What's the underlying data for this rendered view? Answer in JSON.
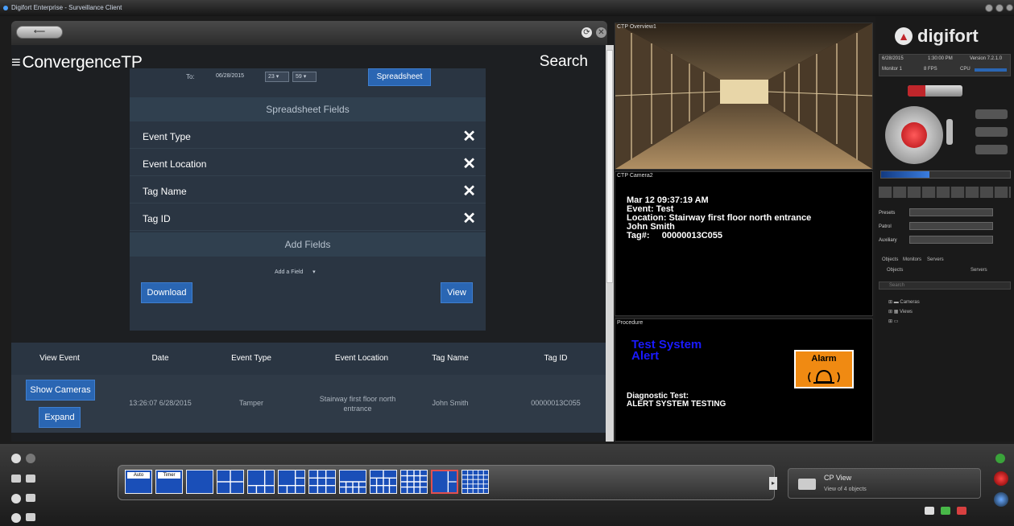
{
  "window": {
    "title": "Digifort Enterprise - Surveillance Client"
  },
  "browser": {
    "back_label": "⟵",
    "home_icon": "home-icon",
    "close_icon": "close-icon"
  },
  "app": {
    "brand": "ConvergenceTP",
    "page_title": "Search",
    "form": {
      "to_label": "To:",
      "to_date": "06/28/2015",
      "to_hour": "23 ▾",
      "to_minute": "59 ▾",
      "spreadsheet_button": "Spreadsheet",
      "spreadsheet_fields_header": "Spreadsheet Fields",
      "fields": [
        "Event Type",
        "Event Location",
        "Tag Name",
        "Tag ID"
      ],
      "add_fields_header": "Add Fields",
      "add_field_select": "Add a Field",
      "download_button": "Download",
      "view_button": "View"
    },
    "table": {
      "headers": [
        "View Event",
        "Date",
        "Event Type",
        "Event Location",
        "Tag Name",
        "Tag ID"
      ],
      "rows": [
        {
          "show_cameras": "Show Cameras",
          "expand": "Expand",
          "date": "13:26:07 6/28/2015",
          "event_type": "Tamper",
          "event_location": "Stairway first floor north entrance",
          "tag_name": "John Smith",
          "tag_id": "00000013C055"
        }
      ]
    }
  },
  "cameras": {
    "cam1_label": "CTP Overview1",
    "cam2_label": "CTP Camera2",
    "osd": {
      "line1": "Mar 12 09:37:19 AM",
      "line2": "Event:  Test",
      "line3": "Location: Stairway first floor north entrance",
      "line4": "John Smith",
      "line5": "Tag#:     00000013C055"
    },
    "procedure_label": "Procedure",
    "alert_title_1": "Test System",
    "alert_title_2": "Alert",
    "alarm_label": "Alarm",
    "diag_1": "Diagnostic Test:",
    "diag_2": "ALERT SYSTEM TESTING"
  },
  "right_panel": {
    "logo": "digifort",
    "status": {
      "date": "6/28/2015",
      "time": "1:30:00 PM",
      "version": "Version 7.2.1.0",
      "monitor": "Monitor 1",
      "fps": "8 FPS",
      "cpu": "CPU"
    },
    "labels": {
      "presets": "Presets",
      "patrol": "Patrol",
      "auxiliary": "Auxiliary"
    },
    "tabs": [
      "Objects",
      "Monitors",
      "Servers"
    ],
    "radios": [
      "Objects",
      "Servers"
    ],
    "search_placeholder": "Search",
    "tree": [
      "Cameras",
      "Views"
    ]
  },
  "dock": {
    "layout_labels": [
      "Auto",
      "Timer"
    ],
    "view_title": "CP View",
    "view_subtitle": "View of 4 objects"
  },
  "colors": {
    "accent_blue": "#2a66b3",
    "panel_navy": "#2a3542",
    "alert_blue": "#1a1aff",
    "alarm_orange": "#f08a12"
  }
}
